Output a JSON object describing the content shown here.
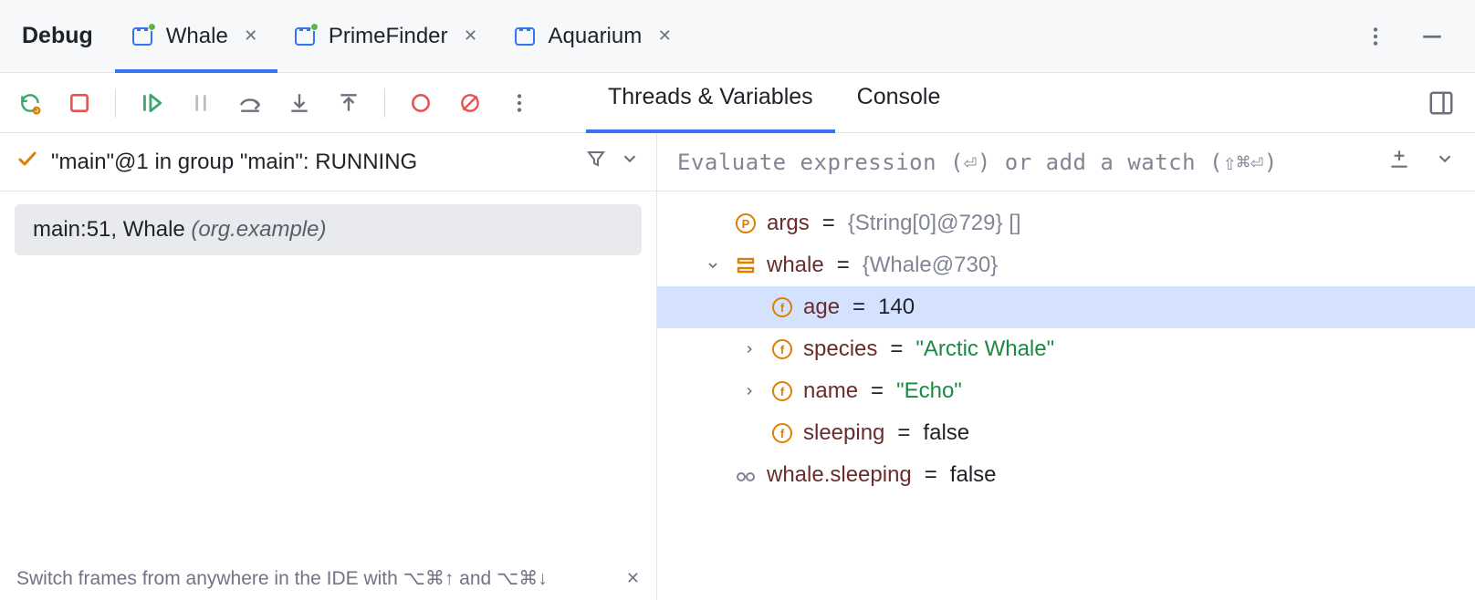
{
  "title": "Debug",
  "tabs": [
    {
      "label": "Whale",
      "active": true
    },
    {
      "label": "PrimeFinder",
      "active": false
    },
    {
      "label": "Aquarium",
      "active": false
    }
  ],
  "toolbar_tabs": {
    "threads": "Threads & Variables",
    "console": "Console"
  },
  "thread_status": "\"main\"@1 in group \"main\": RUNNING",
  "eval_placeholder": "Evaluate expression (⏎) or add a watch (⇧⌘⏎)",
  "stack_frame": {
    "loc": "main:51, Whale ",
    "pkg": "(org.example)"
  },
  "hint": {
    "text": "Switch frames from anywhere in the IDE with ⌥⌘↑ and ⌥⌘↓"
  },
  "vars": {
    "args": {
      "name": "args",
      "value": "{String[0]@729} []"
    },
    "whale": {
      "name": "whale",
      "value": "{Whale@730}"
    },
    "age": {
      "name": "age",
      "value": "140"
    },
    "species": {
      "name": "species",
      "value": "\"Arctic Whale\""
    },
    "vname": {
      "name": "name",
      "value": "\"Echo\""
    },
    "sleeping": {
      "name": "sleeping",
      "value": "false"
    },
    "watch": {
      "name": "whale.sleeping",
      "value": "false"
    }
  }
}
